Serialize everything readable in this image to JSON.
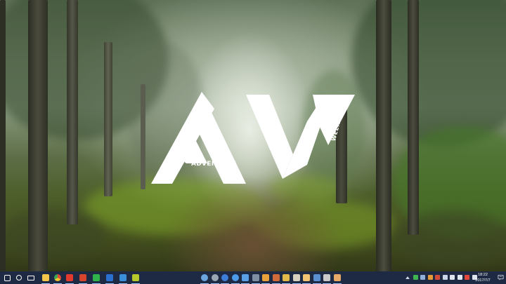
{
  "wallpaper": {
    "logo_letters": "AW",
    "logo_word_adventure": "ADVENTURE",
    "logo_word_weekdays": "WEEKDAYS"
  },
  "taskbar": {
    "left_buttons": [
      {
        "name": "start-button-icon",
        "color": "#ffffff",
        "active": false
      },
      {
        "name": "cortana-search-icon",
        "color": "#ffffff",
        "active": false
      },
      {
        "name": "task-view-icon",
        "color": "#ffffff",
        "active": false
      },
      {
        "name": "file-explorer-icon",
        "color": "#f3c54a",
        "active": true
      },
      {
        "name": "chrome-browser-icon",
        "color": "#e0463a",
        "active": true
      },
      {
        "name": "red-app-icon",
        "color": "#e23b2e",
        "active": true
      },
      {
        "name": "office-app-icon",
        "color": "#d8452c",
        "active": true
      },
      {
        "name": "green-app-icon",
        "color": "#2fb34a",
        "active": true
      },
      {
        "name": "blue-app-icon",
        "color": "#2b6fcf",
        "active": true
      },
      {
        "name": "checkmark-app-icon",
        "color": "#3a8fd8",
        "active": true
      },
      {
        "name": "yellow-green-app-icon",
        "color": "#b5c92a",
        "active": true
      }
    ],
    "center_buttons": [
      {
        "name": "browser-globe-icon",
        "color": "#6aa5e0"
      },
      {
        "name": "gear-app-icon",
        "color": "#9aa7b5"
      },
      {
        "name": "globe-app-icon",
        "color": "#3d7fd8"
      },
      {
        "name": "safari-compass-icon",
        "color": "#4d9be8"
      },
      {
        "name": "folder-icon",
        "color": "#5aa0e6"
      },
      {
        "name": "monitor-icon",
        "color": "#7f8fa3"
      },
      {
        "name": "paint-icon",
        "color": "#e9a23b"
      },
      {
        "name": "gallery-icon",
        "color": "#cf6a3a"
      },
      {
        "name": "grid-app-icon",
        "color": "#e3b84a"
      },
      {
        "name": "star-app-icon",
        "color": "#d6d0c0"
      },
      {
        "name": "notes-icon",
        "color": "#f0c472"
      },
      {
        "name": "feather-icon",
        "color": "#5a8fd2"
      },
      {
        "name": "pen-icon",
        "color": "#c9c9c9"
      },
      {
        "name": "image-app-icon",
        "color": "#e8a86a"
      }
    ],
    "tray_icons": [
      {
        "name": "chevron-up-icon",
        "color": "#cfd6e3"
      },
      {
        "name": "green-tray-icon",
        "color": "#3fb34f"
      },
      {
        "name": "cloud-tray-icon",
        "color": "#8fb0d8"
      },
      {
        "name": "orange-tray-icon",
        "color": "#e59a3a"
      },
      {
        "name": "shield-tray-icon",
        "color": "#d24a3a"
      },
      {
        "name": "cloud-sync-icon",
        "color": "#c9d6e8"
      },
      {
        "name": "network-icon",
        "color": "#dfe5ef"
      },
      {
        "name": "volume-icon",
        "color": "#dfe5ef"
      },
      {
        "name": "input-method-icon",
        "color": "#e0463a"
      },
      {
        "name": "battery-icon",
        "color": "#dfe5ef"
      }
    ],
    "clock_time": "18:22",
    "clock_date": "2017/7/7"
  }
}
